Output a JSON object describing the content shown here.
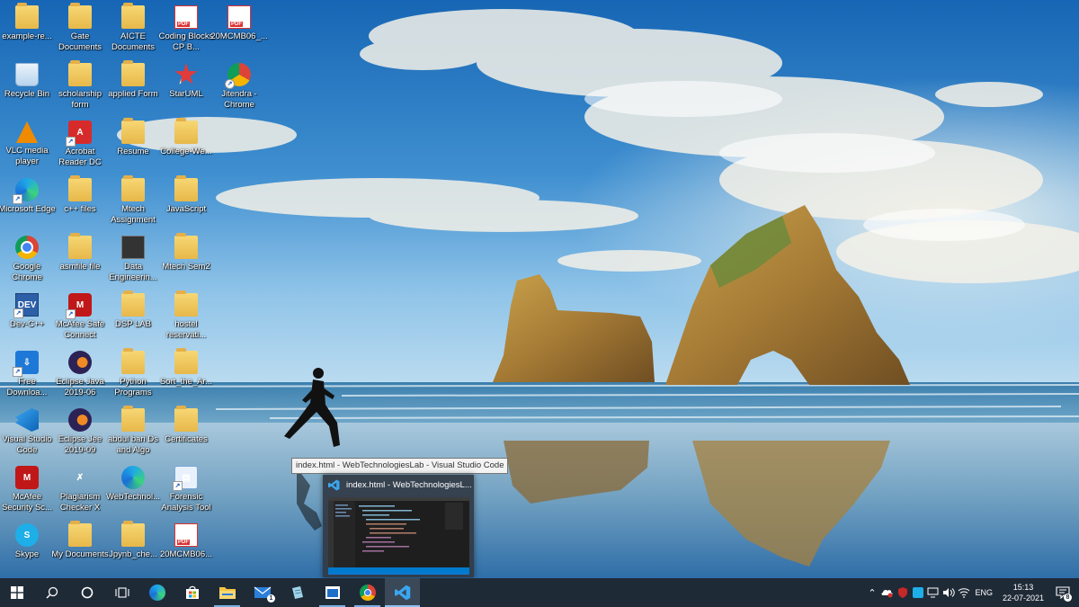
{
  "desktop": {
    "icons": [
      {
        "label": "example-re...",
        "icon": "folder-icon"
      },
      {
        "label": "Gate Documents",
        "icon": "folder-icon"
      },
      {
        "label": "AICTE Documents",
        "icon": "folder-icon"
      },
      {
        "label": "Coding Blocks CP B...",
        "icon": "pdf-icon"
      },
      {
        "label": "20MCMB06_...",
        "icon": "pdf-icon"
      },
      {
        "label": "Recycle Bin",
        "icon": "recycle-bin-icon"
      },
      {
        "label": "scholarship form",
        "icon": "folder-icon"
      },
      {
        "label": "applied Form",
        "icon": "folder-icon"
      },
      {
        "label": "StarUML",
        "icon": "staruml-icon"
      },
      {
        "label": "Jitendra - Chrome",
        "icon": "chrome-icon"
      },
      {
        "label": "VLC media player",
        "icon": "vlc-icon"
      },
      {
        "label": "Acrobat Reader DC",
        "icon": "acrobat-icon"
      },
      {
        "label": "Resume",
        "icon": "folder-icon"
      },
      {
        "label": "College-We...",
        "icon": "folder-icon"
      },
      {
        "label": "Microsoft Edge",
        "icon": "edge-icon"
      },
      {
        "label": "c++ files",
        "icon": "folder-icon"
      },
      {
        "label": "Mtech Assignment",
        "icon": "folder-icon"
      },
      {
        "label": "JavaScript",
        "icon": "folder-icon"
      },
      {
        "label": "Google Chrome",
        "icon": "chrome-icon"
      },
      {
        "label": "asmfile file",
        "icon": "folder-icon"
      },
      {
        "label": "Data Engineerin...",
        "icon": "file-icon"
      },
      {
        "label": "Mtech Sem2",
        "icon": "folder-icon"
      },
      {
        "label": "Dev-C++",
        "icon": "devcpp-icon"
      },
      {
        "label": "McAfee Safe Connect",
        "icon": "mcafee-safe-connect-icon"
      },
      {
        "label": "DSP LAB",
        "icon": "folder-icon"
      },
      {
        "label": "hostel reservati...",
        "icon": "folder-icon"
      },
      {
        "label": "Free Downloa...",
        "icon": "download-icon"
      },
      {
        "label": "Eclipse Java 2019-06",
        "icon": "eclipse-icon"
      },
      {
        "label": "Python Programs",
        "icon": "folder-icon"
      },
      {
        "label": "Sort_the_Ar...",
        "icon": "folder-icon"
      },
      {
        "label": "Visual Studio Code",
        "icon": "vscode-icon"
      },
      {
        "label": "Eclipse Jee 2019-09",
        "icon": "eclipse-icon"
      },
      {
        "label": "abdul bari Ds and Algo",
        "icon": "folder-icon"
      },
      {
        "label": "Certificates",
        "icon": "folder-icon"
      },
      {
        "label": "McAfee Security Sc...",
        "icon": "mcafee-icon"
      },
      {
        "label": "Plagiarism Checker X",
        "icon": "plagiarism-icon"
      },
      {
        "label": "WebTechnol...",
        "icon": "edge-icon"
      },
      {
        "label": "Forensic Analysis Tool",
        "icon": "forensic-icon"
      },
      {
        "label": "Skype",
        "icon": "skype-icon"
      },
      {
        "label": "My Documents",
        "icon": "folder-icon"
      },
      {
        "label": "Jpynb_che...",
        "icon": "folder-icon"
      },
      {
        "label": "20MCMB06...",
        "icon": "pdf-icon"
      }
    ]
  },
  "tooltip": {
    "text": "index.html - WebTechnologiesLab - Visual Studio Code"
  },
  "preview": {
    "title": "index.html - WebTechnologiesL..."
  },
  "taskbar": {
    "buttons": [
      {
        "name": "start-button",
        "icon": "windows-logo-icon"
      },
      {
        "name": "search-button",
        "icon": "search-icon"
      },
      {
        "name": "cortana-button",
        "icon": "cortana-circle-icon"
      },
      {
        "name": "task-view-button",
        "icon": "task-view-icon"
      },
      {
        "name": "edge-taskbar-button",
        "icon": "edge-icon"
      },
      {
        "name": "store-taskbar-button",
        "icon": "store-icon"
      },
      {
        "name": "file-explorer-taskbar-button",
        "icon": "file-explorer-icon"
      },
      {
        "name": "mail-taskbar-button",
        "icon": "mail-icon"
      },
      {
        "name": "notepad-taskbar-button",
        "icon": "notepad-icon"
      },
      {
        "name": "app-taskbar-button",
        "icon": "window-app-icon"
      },
      {
        "name": "chrome-taskbar-button",
        "icon": "chrome-icon"
      },
      {
        "name": "vscode-taskbar-button",
        "icon": "vscode-icon"
      }
    ],
    "mail_badge": "1"
  },
  "tray": {
    "language": "ENG",
    "time": "15:13",
    "date": "22-07-2021",
    "notification_count": "8"
  },
  "colors": {
    "taskbar": "#1f2a37",
    "accent": "#0a78d4"
  }
}
